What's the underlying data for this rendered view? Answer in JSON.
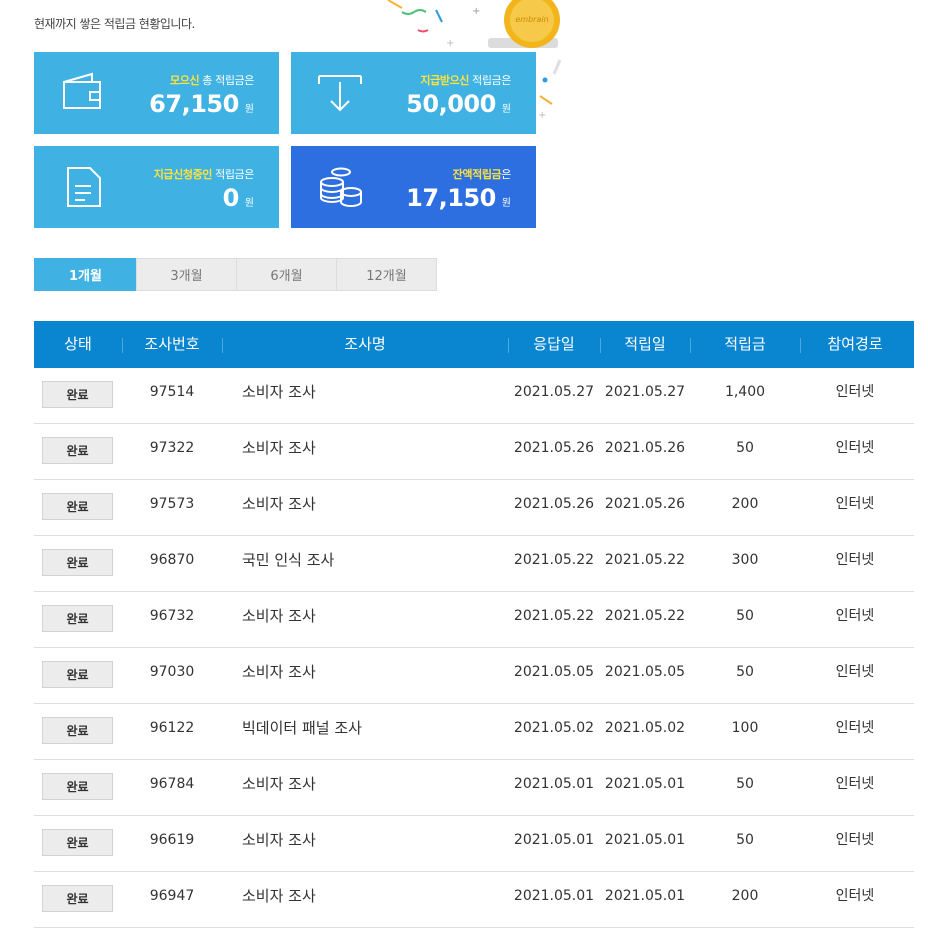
{
  "intro": "현재까지 쌓은 적립금 현황입니다.",
  "illustration": {
    "coin_text": "embrain"
  },
  "cards": [
    {
      "highlight": "모으신",
      "label": " 총 적립금은",
      "amount": "67,150",
      "unit": "원",
      "icon": "wallet-icon"
    },
    {
      "highlight": "지급받으신",
      "label": " 적립금은",
      "amount": "50,000",
      "unit": "원",
      "icon": "download-icon"
    },
    {
      "highlight": "지급신청중인",
      "label": " 적립금은",
      "amount": "0",
      "unit": "원",
      "icon": "document-icon"
    },
    {
      "highlight": "잔액적립금",
      "label": "은",
      "amount": "17,150",
      "unit": "원",
      "icon": "coins-icon"
    }
  ],
  "tabs": [
    {
      "label": "1개월",
      "active": true
    },
    {
      "label": "3개월",
      "active": false
    },
    {
      "label": "6개월",
      "active": false
    },
    {
      "label": "12개월",
      "active": false
    }
  ],
  "table": {
    "headers": {
      "status": "상태",
      "survey_no": "조사번호",
      "survey_name": "조사명",
      "response_date": "응답일",
      "earned_date": "적립일",
      "amount": "적립금",
      "channel": "참여경로"
    },
    "rows": [
      {
        "status": "완료",
        "survey_no": "97514",
        "survey_name": "소비자 조사",
        "response_date": "2021.05.27",
        "earned_date": "2021.05.27",
        "amount": "1,400",
        "channel": "인터넷"
      },
      {
        "status": "완료",
        "survey_no": "97322",
        "survey_name": "소비자 조사",
        "response_date": "2021.05.26",
        "earned_date": "2021.05.26",
        "amount": "50",
        "channel": "인터넷"
      },
      {
        "status": "완료",
        "survey_no": "97573",
        "survey_name": "소비자 조사",
        "response_date": "2021.05.26",
        "earned_date": "2021.05.26",
        "amount": "200",
        "channel": "인터넷"
      },
      {
        "status": "완료",
        "survey_no": "96870",
        "survey_name": "국민 인식 조사",
        "response_date": "2021.05.22",
        "earned_date": "2021.05.22",
        "amount": "300",
        "channel": "인터넷"
      },
      {
        "status": "완료",
        "survey_no": "96732",
        "survey_name": "소비자 조사",
        "response_date": "2021.05.22",
        "earned_date": "2021.05.22",
        "amount": "50",
        "channel": "인터넷"
      },
      {
        "status": "완료",
        "survey_no": "97030",
        "survey_name": "소비자 조사",
        "response_date": "2021.05.05",
        "earned_date": "2021.05.05",
        "amount": "50",
        "channel": "인터넷"
      },
      {
        "status": "완료",
        "survey_no": "96122",
        "survey_name": "빅데이터 패널 조사",
        "response_date": "2021.05.02",
        "earned_date": "2021.05.02",
        "amount": "100",
        "channel": "인터넷"
      },
      {
        "status": "완료",
        "survey_no": "96784",
        "survey_name": "소비자 조사",
        "response_date": "2021.05.01",
        "earned_date": "2021.05.01",
        "amount": "50",
        "channel": "인터넷"
      },
      {
        "status": "완료",
        "survey_no": "96619",
        "survey_name": "소비자 조사",
        "response_date": "2021.05.01",
        "earned_date": "2021.05.01",
        "amount": "50",
        "channel": "인터넷"
      },
      {
        "status": "완료",
        "survey_no": "96947",
        "survey_name": "소비자 조사",
        "response_date": "2021.05.01",
        "earned_date": "2021.05.01",
        "amount": "200",
        "channel": "인터넷"
      }
    ]
  },
  "colors": {
    "card_blue": "#3fb2e3",
    "card_dark_blue": "#2d6fe0",
    "header_blue": "#0a86d1",
    "highlight_yellow": "#ffe23a"
  }
}
